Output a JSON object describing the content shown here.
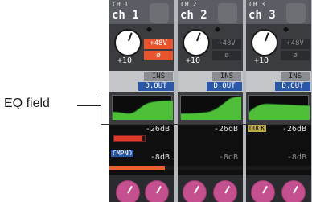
{
  "callout": {
    "label": "EQ field"
  },
  "channels": [
    {
      "sub_label": "CH 1",
      "name": "ch 1",
      "knob_value": "+10",
      "phantom_label": "+48V",
      "phantom_on": true,
      "phase_label": "ø",
      "phase_on": true,
      "ins_label": "INS",
      "dout_label": "D.OUT",
      "dyn1_value": "-26dB",
      "dyn1_tag": "",
      "gate_level": 0.9,
      "dyn2_tag": "CMPND",
      "dyn2_value": "-8dB",
      "comp_level": 0.85
    },
    {
      "sub_label": "CH 2",
      "name": "ch 2",
      "knob_value": "+10",
      "phantom_label": "+48V",
      "phantom_on": false,
      "phase_label": "ø",
      "phase_on": false,
      "ins_label": "INS",
      "dout_label": "D.OUT",
      "dyn1_value": "-26dB",
      "dyn1_tag": "",
      "gate_level": 0.0,
      "dyn2_tag": "",
      "dyn2_value": "-8dB",
      "comp_level": 0.0
    },
    {
      "sub_label": "CH 3",
      "name": "ch 3",
      "knob_value": "+10",
      "phantom_label": "+48V",
      "phantom_on": false,
      "phase_label": "ø",
      "phase_on": false,
      "ins_label": "INS",
      "dout_label": "D.OUT",
      "dyn1_value": "-26dB",
      "dyn1_tag": "DUCK",
      "gate_level": 0.0,
      "dyn2_tag": "",
      "dyn2_value": "-8dB",
      "comp_level": 0.0
    }
  ],
  "colors": {
    "active_red": "#e8542e",
    "eq_curve": "#4fbf3a",
    "dout_blue": "#2a57a8",
    "pink_knob": "#c5508f"
  }
}
